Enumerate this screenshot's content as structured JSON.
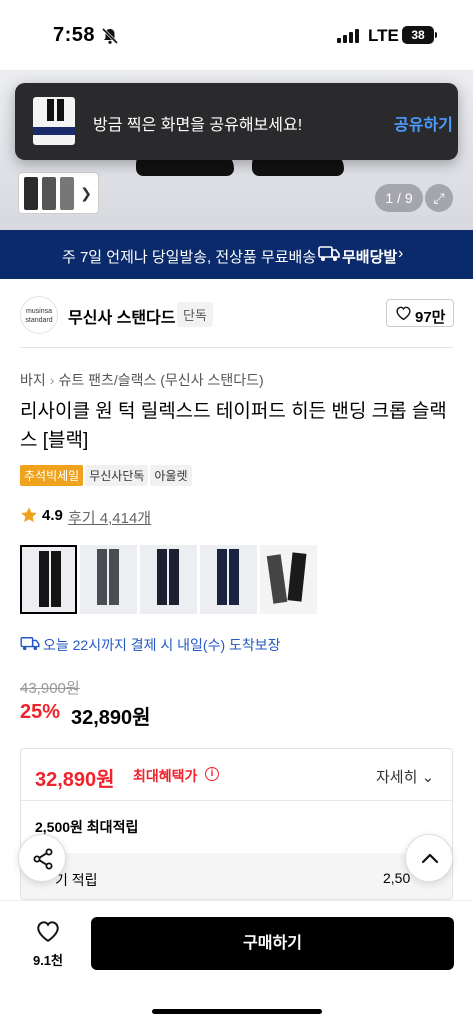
{
  "status": {
    "time": "7:58",
    "network": "LTE",
    "battery": "38"
  },
  "toast": {
    "message": "방금 찍은 화면을 공유해보세요!",
    "action": "공유하기"
  },
  "gallery": {
    "counter": "1 / 9"
  },
  "shipping_banner": {
    "text": "주 7일 언제나 당일발송, 전상품 무료배송",
    "badge": "무배당발"
  },
  "brand": {
    "logo_text": "musinsa standard",
    "name": "무신사 스탠다드",
    "badge": "단독",
    "likes": "97만"
  },
  "breadcrumb": [
    "바지",
    "슈트 팬츠/슬랙스 (무신사 스탠다드)"
  ],
  "product": {
    "title": "리사이클 원 턱 릴렉스드 테이퍼드 히든 밴딩 크롭 슬랙스 [블랙]",
    "tags": [
      "추석빅세일",
      "무신사단독",
      "아울렛"
    ],
    "rating": "4.9",
    "reviews": "후기 4,414개",
    "delivery": "오늘 22시까지 결제 시 내일(수) 도착보장",
    "original_price": "43,900원",
    "discount": "25%",
    "sale_price": "32,890원"
  },
  "swatches": [
    {
      "name": "black",
      "color": "#141414"
    },
    {
      "name": "charcoal",
      "color": "#4a4d52"
    },
    {
      "name": "navy-dark",
      "color": "#1c2030"
    },
    {
      "name": "navy",
      "color": "#1a2440"
    },
    {
      "name": "flat",
      "color": "#2a2a2a"
    }
  ],
  "benefit": {
    "price": "32,890원",
    "label": "최대혜택가",
    "detail": "자세히",
    "points_max": "2,500원 최대적립",
    "points_row_label": "기 적립",
    "points_row_value": "2,50"
  },
  "bottom": {
    "wish_count": "9.1천",
    "buy": "구매하기"
  },
  "colors": {
    "accent_red": "#f0222b",
    "banner_navy": "#0a2a6b",
    "link_blue": "#2458c6",
    "sale_tag": "#f0a21d"
  }
}
